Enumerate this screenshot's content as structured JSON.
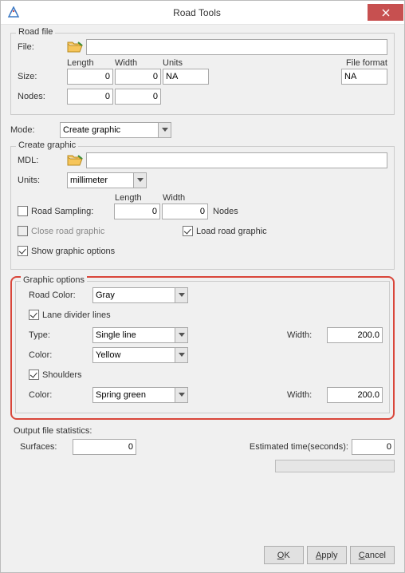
{
  "window": {
    "title": "Road Tools"
  },
  "road_file": {
    "legend": "Road file",
    "file_label": "File:",
    "file_value": "",
    "headers": {
      "length": "Length",
      "width": "Width",
      "units": "Units",
      "file_format": "File format"
    },
    "size_label": "Size:",
    "size_length": "0",
    "size_width": "0",
    "size_units": "NA",
    "size_format": "NA",
    "nodes_label": "Nodes:",
    "nodes_length": "0",
    "nodes_width": "0"
  },
  "mode": {
    "label": "Mode:",
    "value": "Create graphic"
  },
  "create_graphic": {
    "legend": "Create graphic",
    "mdl_label": "MDL:",
    "mdl_value": "",
    "units_label": "Units:",
    "units_value": "millimeter",
    "headers": {
      "length": "Length",
      "width": "Width"
    },
    "road_sampling_label": "Road Sampling:",
    "road_sampling_checked": false,
    "road_sampling_length": "0",
    "road_sampling_width": "0",
    "nodes_suffix": "Nodes",
    "close_label": "Close road graphic",
    "close_checked": false,
    "load_label": "Load road graphic",
    "load_checked": true,
    "show_label": "Show graphic options",
    "show_checked": true
  },
  "graphic_options": {
    "legend": "Graphic options",
    "road_color_label": "Road Color:",
    "road_color_value": "Gray",
    "lane_divider_label": "Lane divider lines",
    "lane_divider_checked": true,
    "type_label": "Type:",
    "type_value": "Single line",
    "width_label": "Width:",
    "width_value": "200.0",
    "color_label": "Color:",
    "color_value": "Yellow",
    "shoulders_label": "Shoulders",
    "shoulders_checked": true,
    "shoulder_color_label": "Color:",
    "shoulder_color_value": "Spring green",
    "shoulder_width_label": "Width:",
    "shoulder_width_value": "200.0"
  },
  "output_stats": {
    "label": "Output file statistics:",
    "surfaces_label": "Surfaces:",
    "surfaces_value": "0",
    "est_label": "Estimated time(seconds):",
    "est_value": "0"
  },
  "buttons": {
    "ok": "OK",
    "apply": "Apply",
    "cancel": "Cancel"
  }
}
